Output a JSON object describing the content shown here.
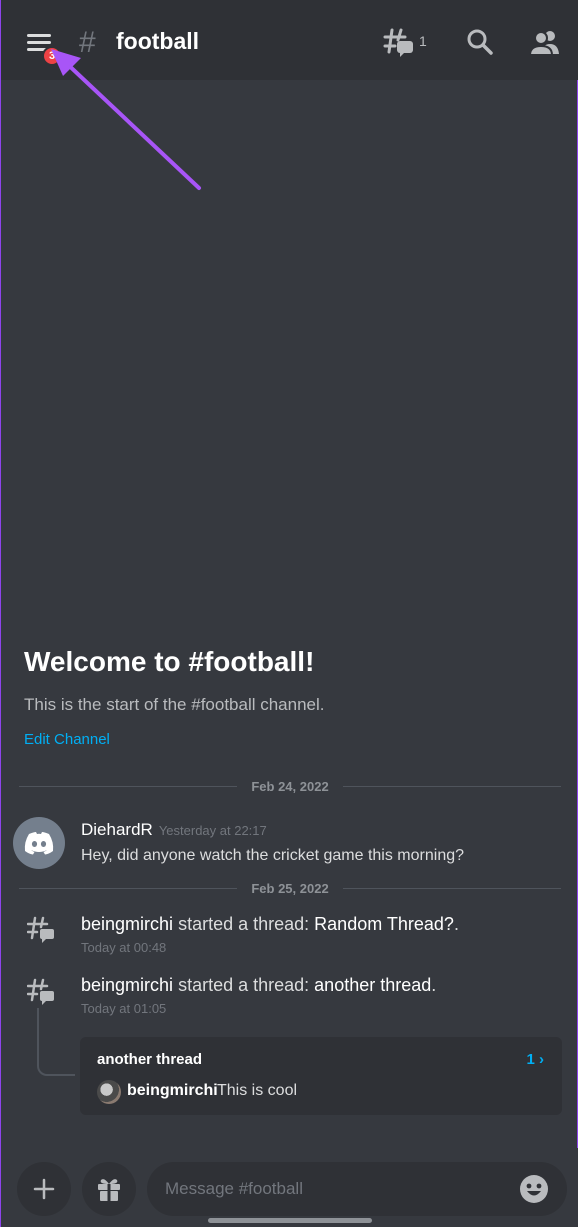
{
  "header": {
    "menu_badge": "3",
    "hash_symbol": "#",
    "channel_name": "football",
    "threads_count": "1"
  },
  "welcome": {
    "title": "Welcome to #football!",
    "subtitle": "This is the start of the #football channel.",
    "edit_link": "Edit Channel"
  },
  "dividers": [
    "Feb 24, 2022",
    "Feb 25, 2022"
  ],
  "message": {
    "author": "DiehardR",
    "time": "Yesterday at 22:17",
    "text": "Hey, did anyone watch the cricket game this morning?"
  },
  "system_messages": [
    {
      "user": "beingmirchi",
      "action": "started a thread:",
      "thread": "Random Thread?",
      "suffix": ".",
      "time": "Today at 00:48"
    },
    {
      "user": "beingmirchi",
      "action": "started a thread:",
      "thread": "another thread",
      "suffix": ".",
      "time": "Today at 01:05"
    }
  ],
  "thread_card": {
    "name": "another thread",
    "count": "1",
    "preview_author": "beingmirchi",
    "preview_text": "This is cool"
  },
  "composer": {
    "placeholder": "Message #football"
  },
  "colors": {
    "background": "#36393f",
    "header": "#2f3136",
    "link": "#00aff4",
    "badge": "#ed4245",
    "annotation_arrow": "#a855f7"
  }
}
